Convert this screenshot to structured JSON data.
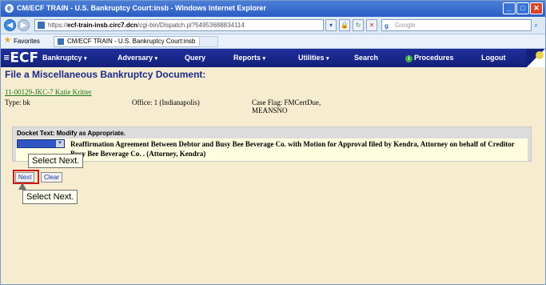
{
  "browser": {
    "title": "CM/ECF TRAIN - U.S. Bankruptcy Court:insb - Windows Internet Explorer",
    "url_prefix": "https://",
    "url_domain": "ecf-train-insb.circ7.dcn",
    "url_path": "/cgi-bin/Dispatch.pl?54953688834114",
    "search_placeholder": "Google",
    "favorites_label": "Favorites",
    "tab_title": "CM/ECF TRAIN - U.S. Bankruptcy Court:insb"
  },
  "ecf_menu": {
    "logo": "ECF",
    "items": [
      {
        "label": "Bankruptcy",
        "has_dropdown": true
      },
      {
        "label": "Adversary",
        "has_dropdown": true
      },
      {
        "label": "Query",
        "has_dropdown": false
      },
      {
        "label": "Reports",
        "has_dropdown": true
      },
      {
        "label": "Utilities",
        "has_dropdown": true
      },
      {
        "label": "Search",
        "has_dropdown": false
      },
      {
        "label": "Procedures",
        "has_dropdown": false
      },
      {
        "label": "Logout",
        "has_dropdown": false
      }
    ]
  },
  "page": {
    "title": "File a Miscellaneous Bankruptcy Document:",
    "case_link": "11-00129-JKC-7 Katie Kritter",
    "type": "Type: bk",
    "office": "Office: 1 (Indianapolis)",
    "case_flag_line1": "Case Flag: FMCertDue,",
    "case_flag_line2": "MEANSNO"
  },
  "docket": {
    "label": "Docket Text: Modify as Appropriate.",
    "text": "Reaffirmation Agreement Between Debtor and Busy Bee Beverage Co. with Motion for Approval filed by Kendra, Attorney on behalf of Creditor Busy Bee Beverage Co. . (Attorney, Kendra)"
  },
  "buttons": {
    "next": "Next",
    "clear": "Clear"
  },
  "callouts": {
    "first": "Select Next.",
    "second": "Select Next."
  },
  "icons": {
    "back": "back-arrow-icon",
    "forward": "forward-arrow-icon",
    "refresh": "refresh-icon",
    "stop": "stop-icon",
    "favorites": "star-icon",
    "procedures": "info-icon"
  }
}
